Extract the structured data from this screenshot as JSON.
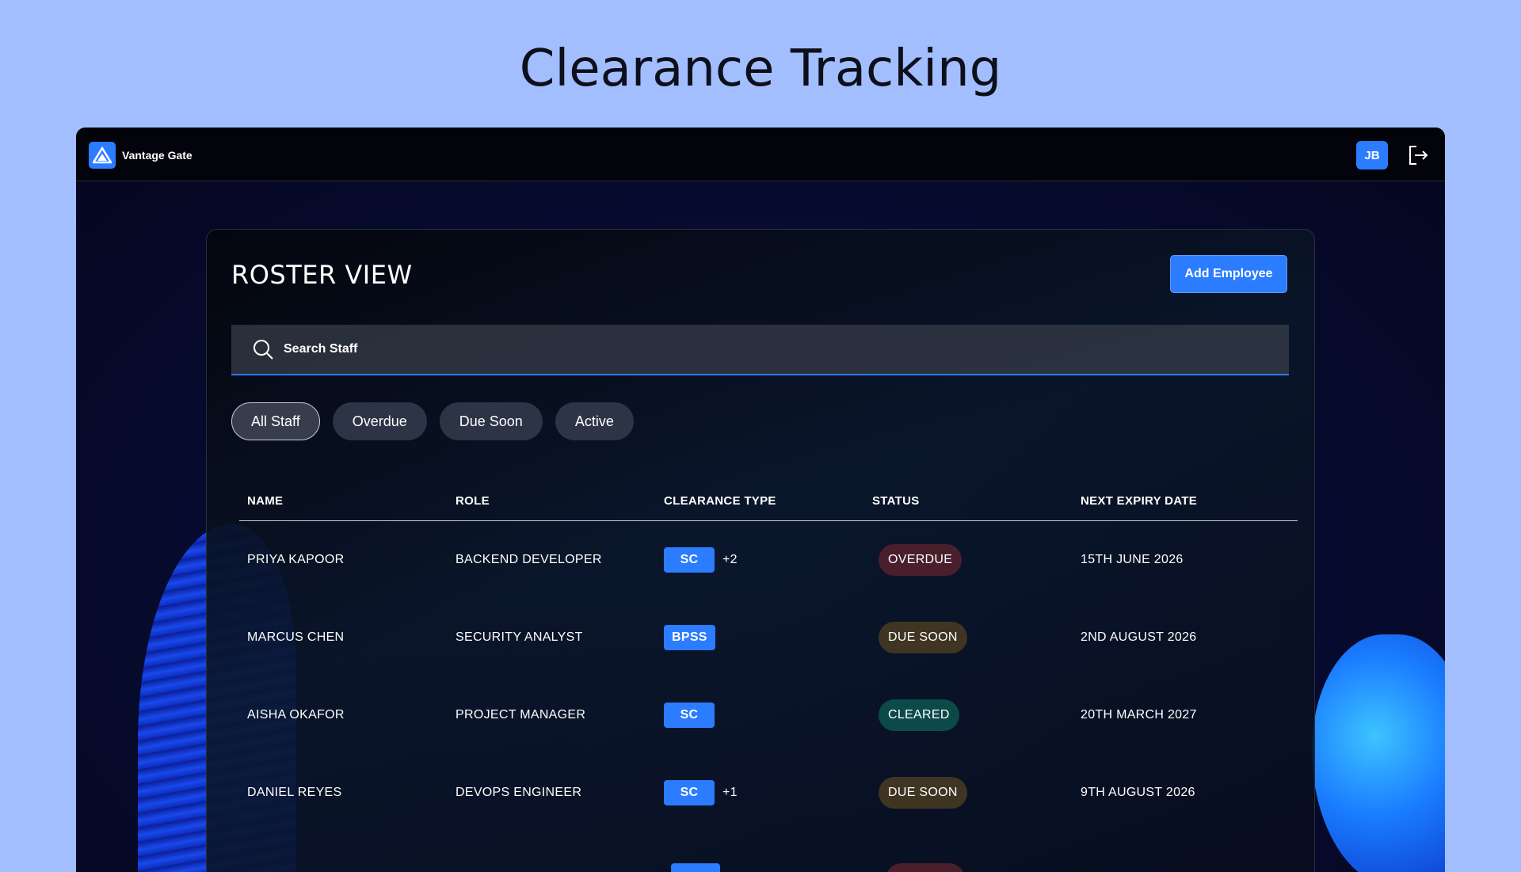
{
  "page": {
    "heading": "Clearance Tracking"
  },
  "topbar": {
    "brand_name": "Vantage Gate",
    "brand_icon": "mountain-logo-icon",
    "avatar_initials": "JB",
    "logout_icon": "logout-icon"
  },
  "roster": {
    "title": "ROSTER VIEW",
    "add_button_label": "Add Employee",
    "search": {
      "placeholder": "Search Staff",
      "value": ""
    },
    "filters": [
      "All Staff",
      "Overdue",
      "Due Soon",
      "Active"
    ],
    "active_filter": "All Staff",
    "columns": [
      "NAME",
      "ROLE",
      "CLEARANCE TYPE",
      "STATUS",
      "NEXT EXPIRY DATE"
    ],
    "rows": [
      {
        "name": "PRIYA KAPOOR",
        "role": "BACKEND DEVELOPER",
        "clearance": "SC",
        "extra": "+2",
        "status": "OVERDUE",
        "expiry": "15TH JUNE 2026"
      },
      {
        "name": "MARCUS CHEN",
        "role": "SECURITY ANALYST",
        "clearance": "BPSS",
        "extra": "",
        "status": "DUE SOON",
        "expiry": "2ND AUGUST 2026"
      },
      {
        "name": "AISHA OKAFOR",
        "role": "PROJECT MANAGER",
        "clearance": "SC",
        "extra": "",
        "status": "CLEARED",
        "expiry": "20TH MARCH 2027"
      },
      {
        "name": "DANIEL REYES",
        "role": "DEVOPS ENGINEER",
        "clearance": "SC",
        "extra": "+1",
        "status": "DUE SOON",
        "expiry": "9TH AUGUST 2026"
      }
    ]
  },
  "colors": {
    "accent": "#2b7cff",
    "background": "#a3befe",
    "overdue": "#4a1f2c",
    "due_soon": "#3f3522",
    "cleared": "#0b4a48"
  }
}
